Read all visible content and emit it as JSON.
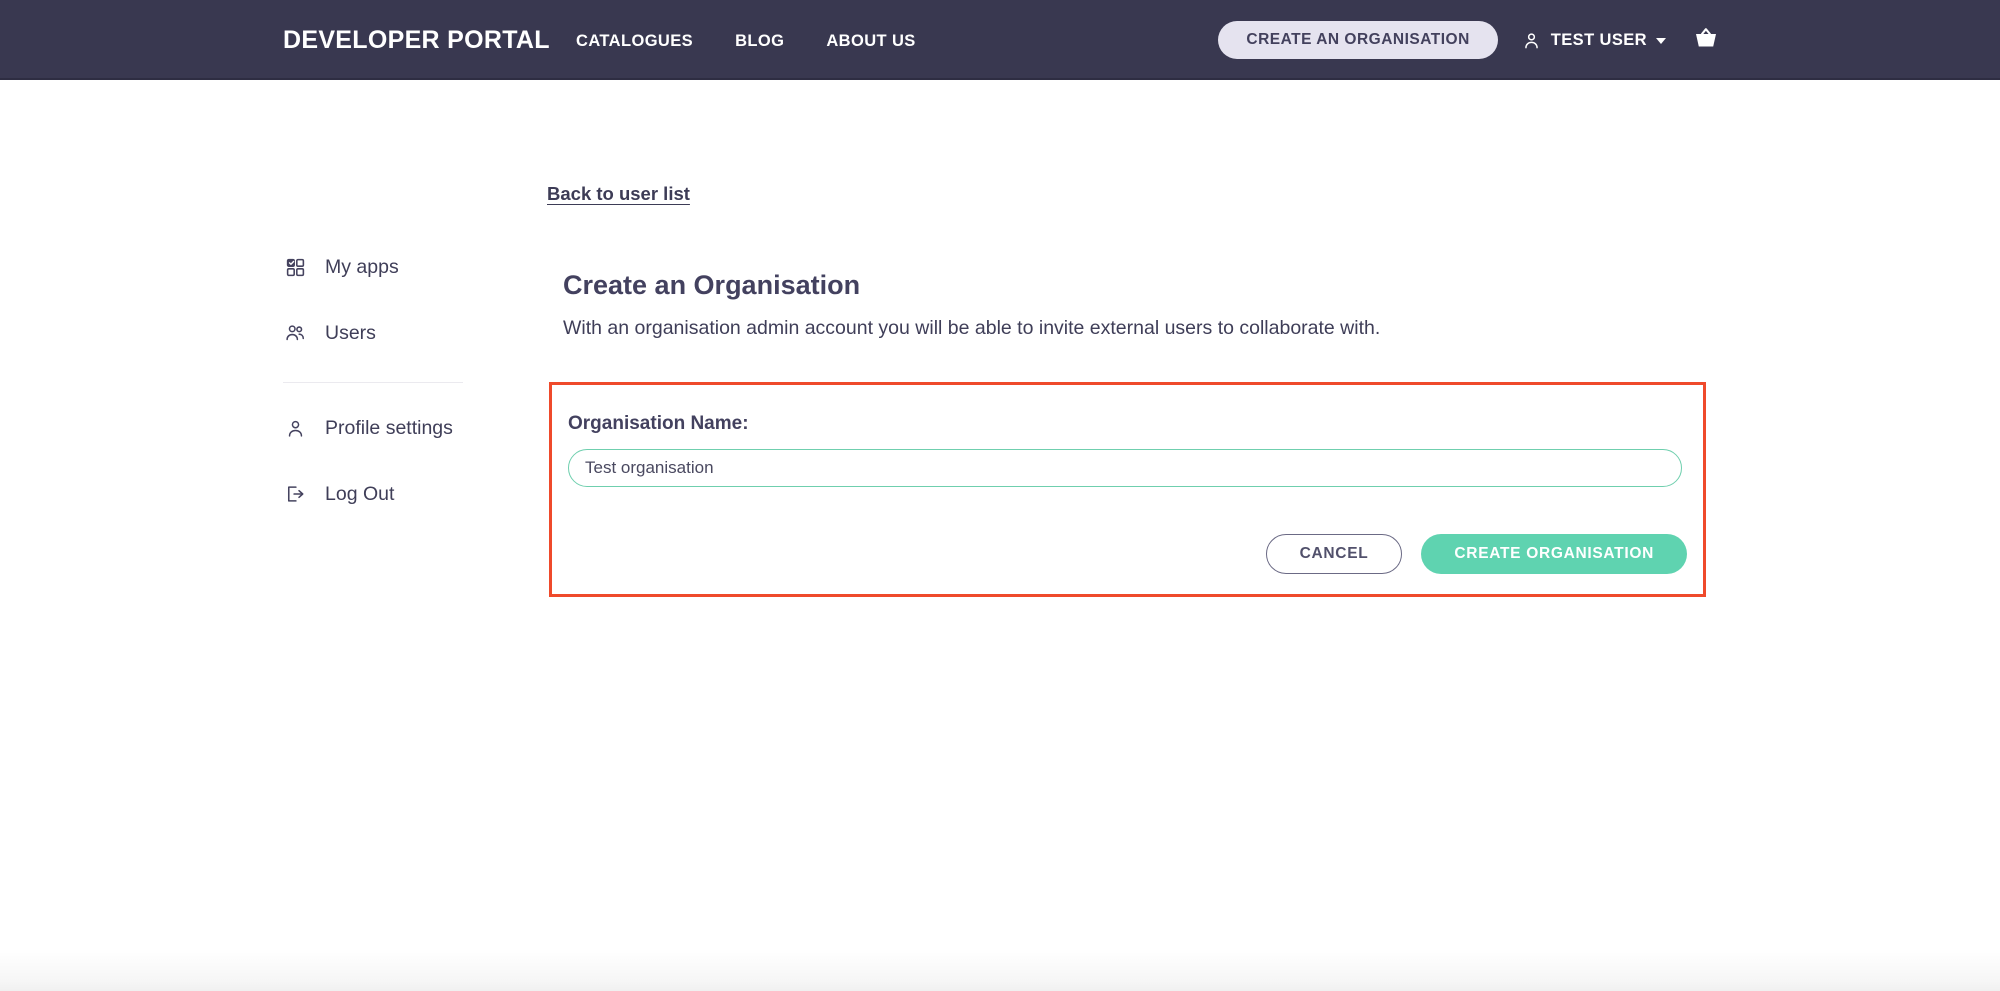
{
  "header": {
    "brand": "DEVELOPER PORTAL",
    "nav": [
      {
        "label": "CATALOGUES"
      },
      {
        "label": "BLOG"
      },
      {
        "label": "ABOUT US"
      }
    ],
    "create_org_pill": "CREATE AN ORGANISATION",
    "user_name": "TEST USER",
    "user_icon": "person-icon",
    "caret_icon": "chevron-down-icon",
    "basket_icon": "basket-icon",
    "background_color": "#393850",
    "pill_color": "#e5e3ef"
  },
  "back_link": "Back to user list",
  "sidebar": {
    "items": [
      {
        "label": "My apps",
        "icon": "grid-apps-icon"
      },
      {
        "label": "Users",
        "icon": "users-icon"
      },
      {
        "label": "Profile settings",
        "icon": "person-icon"
      },
      {
        "label": "Log Out",
        "icon": "logout-icon"
      }
    ]
  },
  "main": {
    "title": "Create an Organisation",
    "description": "With an organisation admin account you will be able to invite external users to collaborate with."
  },
  "form": {
    "field_label": "Organisation Name:",
    "field_value": "Test organisation",
    "field_placeholder": "Organisation Name",
    "cancel_label": "CANCEL",
    "submit_label": "CREATE ORGANISATION",
    "highlight_color": "#ef4a2b",
    "input_border_color": "#6fcfae",
    "submit_color": "#5fd3b0"
  }
}
